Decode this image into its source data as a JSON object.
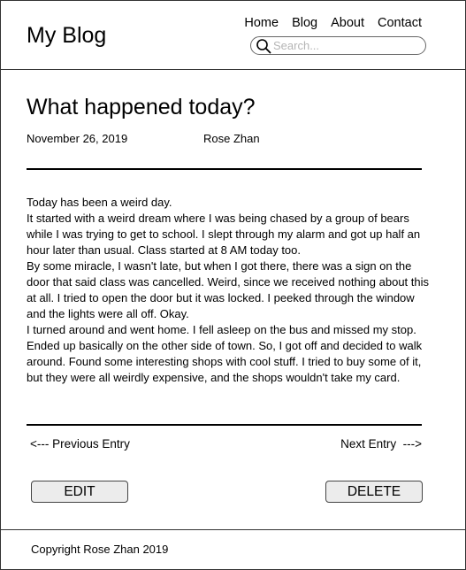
{
  "header": {
    "site_title": "My Blog",
    "nav": [
      "Home",
      "Blog",
      "About",
      "Contact"
    ],
    "search": {
      "placeholder": "Search...",
      "value": "",
      "icon": "search-icon"
    }
  },
  "post": {
    "title": "What happened today?",
    "date": "November 26, 2019",
    "author": "Rose Zhan",
    "body": [
      "Today has been a weird day.",
      "It started with a weird dream where I was being chased by a group of bears while I was trying to get to school. I slept through my alarm and got up half an hour later than usual. Class started at 8 AM today too.",
      "By some miracle, I wasn't late, but when I got there, there was a sign on the door that said class was cancelled. Weird, since we received nothing about this at all. I tried to open the door but it was locked. I peeked through the window and the lights were all off. Okay.",
      "I turned around and went home. I fell asleep on the bus and missed my stop. Ended up basically on the other side of town. So, I got off and decided to walk around. Found some interesting shops with cool stuff. I tried to buy some of it, but they were all weirdly expensive, and the shops wouldn't take my card."
    ]
  },
  "pagination": {
    "previous": "<--- Previous Entry",
    "next": "Next Entry  --->"
  },
  "actions": {
    "edit": "EDIT",
    "delete": "DELETE"
  },
  "footer": {
    "copyright": "Copyright Rose Zhan 2019"
  }
}
